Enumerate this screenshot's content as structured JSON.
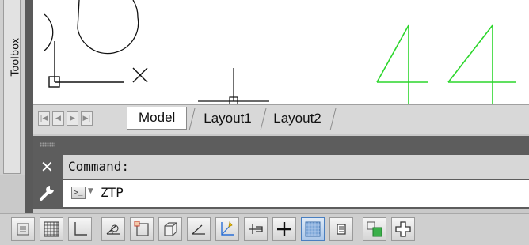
{
  "toolbox": {
    "label": "Toolbox"
  },
  "layout_tabs": {
    "tabs": [
      {
        "label": "Model",
        "active": true
      },
      {
        "label": "Layout1",
        "active": false
      },
      {
        "label": "Layout2",
        "active": false
      }
    ]
  },
  "command": {
    "history_text": "Command:",
    "current_value": "ZTP"
  },
  "canvas": {
    "drawn_digits": "44",
    "digit_color": "#2bd62b",
    "linework_color": "#111111"
  },
  "status_bar": {
    "buttons": [
      {
        "name": "quick-properties-toggle",
        "active": false
      },
      {
        "name": "grid-display-toggle",
        "active": false
      },
      {
        "name": "ortho-mode-toggle",
        "active": false
      },
      {
        "name": "polar-tracking-toggle",
        "active": false
      },
      {
        "name": "object-snap-toggle",
        "active": false
      },
      {
        "name": "3d-object-snap-toggle",
        "active": false
      },
      {
        "name": "object-snap-tracking-toggle",
        "active": false
      },
      {
        "name": "dynamic-ucs-toggle",
        "active": false
      },
      {
        "name": "dynamic-input-toggle",
        "active": false
      },
      {
        "name": "lineweight-toggle",
        "active": false
      },
      {
        "name": "transparency-toggle",
        "active": true
      },
      {
        "name": "quick-properties-panel",
        "active": false
      },
      {
        "name": "selection-cycling-toggle",
        "active": false
      },
      {
        "name": "annotation-monitor-toggle",
        "active": false
      }
    ]
  }
}
